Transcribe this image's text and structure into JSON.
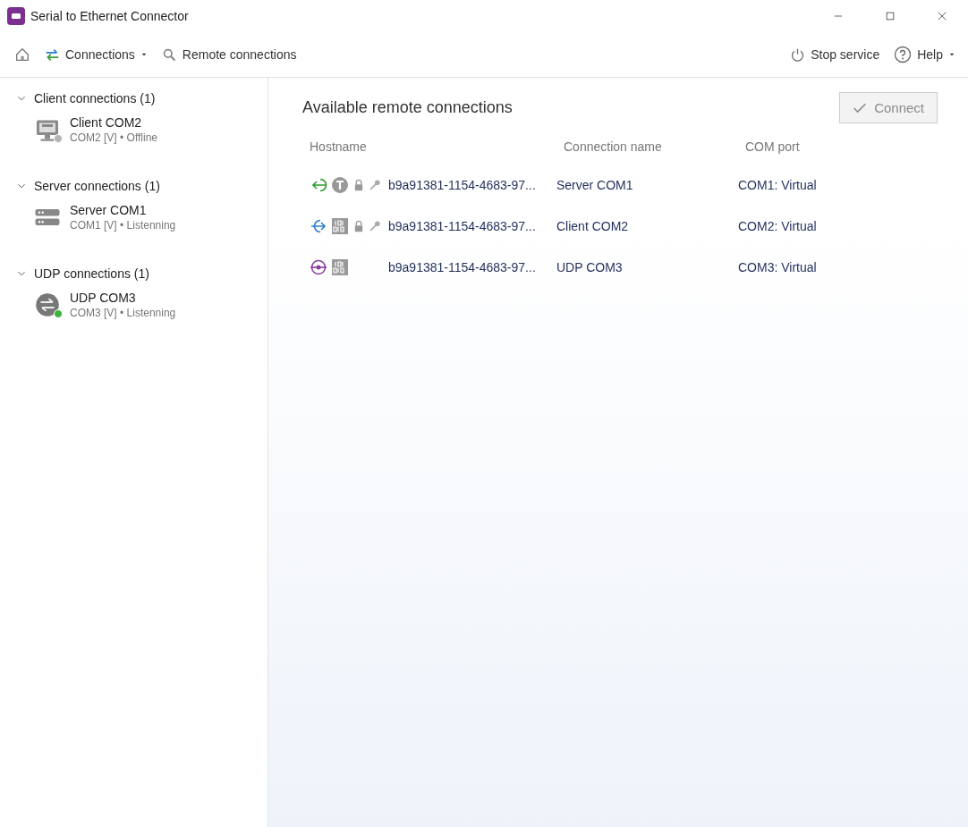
{
  "window": {
    "title": "Serial to Ethernet Connector"
  },
  "toolbar": {
    "left": [
      {
        "kind": "home"
      },
      {
        "kind": "connections",
        "label": "Connections",
        "dropdown": true
      },
      {
        "kind": "search",
        "label": "Remote connections",
        "dropdown": false
      }
    ],
    "right": [
      {
        "kind": "power",
        "label": "Stop service",
        "dropdown": false
      },
      {
        "kind": "help",
        "label": "Help",
        "dropdown": true
      }
    ]
  },
  "sidebar": {
    "groups": [
      {
        "label": "Client connections (1)",
        "expanded": true,
        "items": [
          {
            "kind": "client",
            "name": "Client COM2",
            "detail": "COM2 [V] • Offline",
            "color": "#b4b4b4"
          }
        ]
      },
      {
        "label": "Server connections (1)",
        "expanded": true,
        "items": [
          {
            "kind": "server",
            "name": "Server COM1",
            "detail": "COM1 [V] • Listenning"
          }
        ]
      },
      {
        "label": "UDP connections (1)",
        "expanded": true,
        "items": [
          {
            "kind": "udp",
            "name": "UDP COM3",
            "detail": "COM3 [V] • Listenning",
            "color": "#3cb43c"
          }
        ]
      }
    ]
  },
  "main": {
    "title": "Available remote connections",
    "connect_button": {
      "label": "Connect",
      "disabled": true
    },
    "table": {
      "columns": [
        "Hostname",
        "Connection name",
        "COM port"
      ],
      "rows": [
        {
          "kind": "server",
          "badges": [
            {
              "kind": "telnet"
            },
            {
              "kind": "lock"
            },
            {
              "kind": "key"
            }
          ],
          "hostname": "b9a91381-1154-4683-97...",
          "name": "Server COM1",
          "port": "COM1: Virtual"
        },
        {
          "kind": "client",
          "badges": [
            {
              "kind": "binary"
            },
            {
              "kind": "lock"
            },
            {
              "kind": "key"
            }
          ],
          "hostname": "b9a91381-1154-4683-97...",
          "name": "Client COM2",
          "port": "COM2: Virtual"
        },
        {
          "kind": "udp",
          "badges": [
            {
              "kind": "binary"
            }
          ],
          "hostname": "b9a91381-1154-4683-97...",
          "name": "UDP COM3",
          "port": "COM3: Virtual"
        }
      ]
    }
  }
}
